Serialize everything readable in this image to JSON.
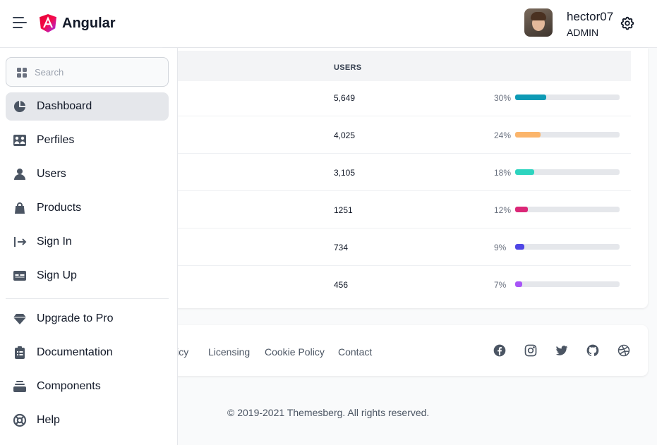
{
  "header": {
    "brand": "Angular",
    "user_name": "hector07",
    "user_role": "ADMIN"
  },
  "sidebar": {
    "search_placeholder": "Search",
    "items": [
      {
        "label": "Dashboard",
        "icon": "chart-pie-icon",
        "active": true
      },
      {
        "label": "Perfiles",
        "icon": "users-group-icon"
      },
      {
        "label": "Users",
        "icon": "user-icon"
      },
      {
        "label": "Products",
        "icon": "shopping-bag-icon"
      },
      {
        "label": "Sign In",
        "icon": "sign-in-icon"
      },
      {
        "label": "Sign Up",
        "icon": "id-card-icon"
      }
    ],
    "secondary_items": [
      {
        "label": "Upgrade to Pro",
        "icon": "diamond-icon"
      },
      {
        "label": "Documentation",
        "icon": "clipboard-list-icon"
      },
      {
        "label": "Components",
        "icon": "collection-icon"
      },
      {
        "label": "Help",
        "icon": "support-icon"
      }
    ]
  },
  "table": {
    "users_header": "USERS",
    "rows": [
      {
        "users": "5,649",
        "percent": "30%",
        "value": 30,
        "color": "#0e9ab5"
      },
      {
        "users": "4,025",
        "percent": "24%",
        "value": 24,
        "color": "#fbb56b"
      },
      {
        "users": "3,105",
        "percent": "18%",
        "value": 18,
        "color": "#2dd4bf"
      },
      {
        "users": "1251",
        "percent": "12%",
        "value": 12,
        "color": "#db2777"
      },
      {
        "users": "734",
        "percent": "9%",
        "value": 9,
        "color": "#4f46e5"
      },
      {
        "users": "456",
        "percent": "7%",
        "value": 7,
        "color": "#a855f7"
      }
    ]
  },
  "footer": {
    "links": [
      "licy",
      "Licensing",
      "Cookie Policy",
      "Contact"
    ],
    "social": [
      "facebook-icon",
      "instagram-icon",
      "twitter-icon",
      "github-icon",
      "dribbble-icon"
    ],
    "copyright": "© 2019-2021 Themesberg. All rights reserved."
  },
  "colors": {
    "brand_pink": "#dd0031",
    "brand_purple": "#c3002f"
  }
}
